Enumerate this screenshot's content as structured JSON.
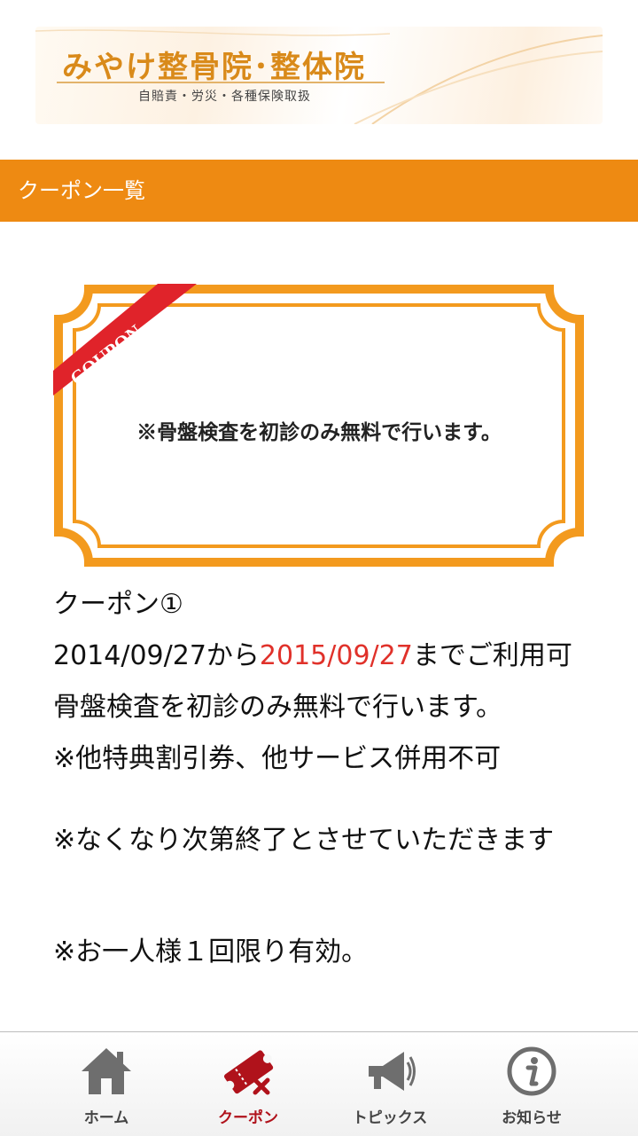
{
  "header": {
    "logo_title": "みやけ整骨院･整体院",
    "logo_subtitle": "自賠責・労災・各種保険取扱"
  },
  "section": {
    "title": "クーポン一覧"
  },
  "coupon_image": {
    "ribbon_text": "COUPON",
    "text": "※骨盤検査を初診のみ無料で行います。",
    "border_color": "#f39a1e",
    "ribbon_color": "#e0232a"
  },
  "coupon": {
    "title": "クーポン①",
    "valid_from": "2014/09/27から",
    "valid_to": "2015/09/27",
    "valid_suffix": "までご利用可",
    "description": "骨盤検査を初診のみ無料で行います。",
    "note1": "※他特典割引券、他サービス併用不可",
    "note2": "※なくなり次第終了とさせていただきます",
    "note3": "※お一人様１回限り有効。"
  },
  "nav": {
    "items": [
      {
        "label": "ホーム",
        "icon": "home-icon"
      },
      {
        "label": "クーポン",
        "icon": "ticket-icon",
        "active": true
      },
      {
        "label": "トピックス",
        "icon": "megaphone-icon"
      },
      {
        "label": "お知らせ",
        "icon": "info-icon"
      }
    ],
    "active_color": "#b0121b"
  }
}
